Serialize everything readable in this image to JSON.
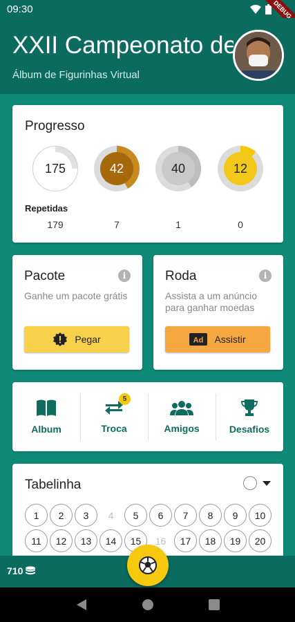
{
  "status": {
    "time": "09:30",
    "debug_label": "DEBUG"
  },
  "header": {
    "title": "XXII Campeonato de",
    "subtitle": "Álbum de Figurinhas Virtual"
  },
  "progress": {
    "title": "Progresso",
    "circles": [
      {
        "value": "175",
        "fraction": 0.25,
        "fill_color": "#e0e0e0",
        "inner_bg": "#ffffff",
        "text_color": "#222222"
      },
      {
        "value": "42",
        "fraction": 0.42,
        "fill_color": "#c88a1e",
        "inner_bg": "#a5690b",
        "text_color": "#ffffff"
      },
      {
        "value": "40",
        "fraction": 0.4,
        "fill_color": "#bdbdbd",
        "inner_bg": "#c9c9c9",
        "text_color": "#222222"
      },
      {
        "value": "12",
        "fraction": 0.12,
        "fill_color": "#f6c90e",
        "inner_bg": "#f2c91b",
        "text_color": "#222222"
      }
    ],
    "repeated_label": "Repetidas",
    "repeated": [
      "179",
      "7",
      "1",
      "0"
    ]
  },
  "pacote": {
    "title": "Pacote",
    "desc": "Ganhe um pacote grátis",
    "button": "Pegar",
    "button_color": "#f8d14a"
  },
  "roda": {
    "title": "Roda",
    "desc": "Assista a um anúncio para ganhar moedas",
    "button": "Assistir",
    "button_color": "#f5a742"
  },
  "nav": {
    "album": "Album",
    "troca": "Troca",
    "troca_badge": "5",
    "amigos": "Amigos",
    "desafios": "Desafios"
  },
  "tabelinha": {
    "title": "Tabelinha",
    "numbers": [
      {
        "n": "1",
        "missing": false
      },
      {
        "n": "2",
        "missing": false
      },
      {
        "n": "3",
        "missing": false
      },
      {
        "n": "4",
        "missing": true
      },
      {
        "n": "5",
        "missing": false
      },
      {
        "n": "6",
        "missing": false
      },
      {
        "n": "7",
        "missing": false
      },
      {
        "n": "8",
        "missing": false
      },
      {
        "n": "9",
        "missing": false
      },
      {
        "n": "10",
        "missing": false
      },
      {
        "n": "11",
        "missing": false
      },
      {
        "n": "12",
        "missing": false
      },
      {
        "n": "13",
        "missing": false
      },
      {
        "n": "14",
        "missing": false
      },
      {
        "n": "15",
        "missing": false
      },
      {
        "n": "16",
        "missing": true
      },
      {
        "n": "17",
        "missing": false
      },
      {
        "n": "18",
        "missing": false
      },
      {
        "n": "19",
        "missing": false
      },
      {
        "n": "20",
        "missing": false
      }
    ]
  },
  "bottom": {
    "coins": "710"
  },
  "colors": {
    "primary": "#0b6b5e",
    "background": "#0f8a79",
    "accent": "#f6c90e",
    "nav_text": "#0f6d5f"
  }
}
